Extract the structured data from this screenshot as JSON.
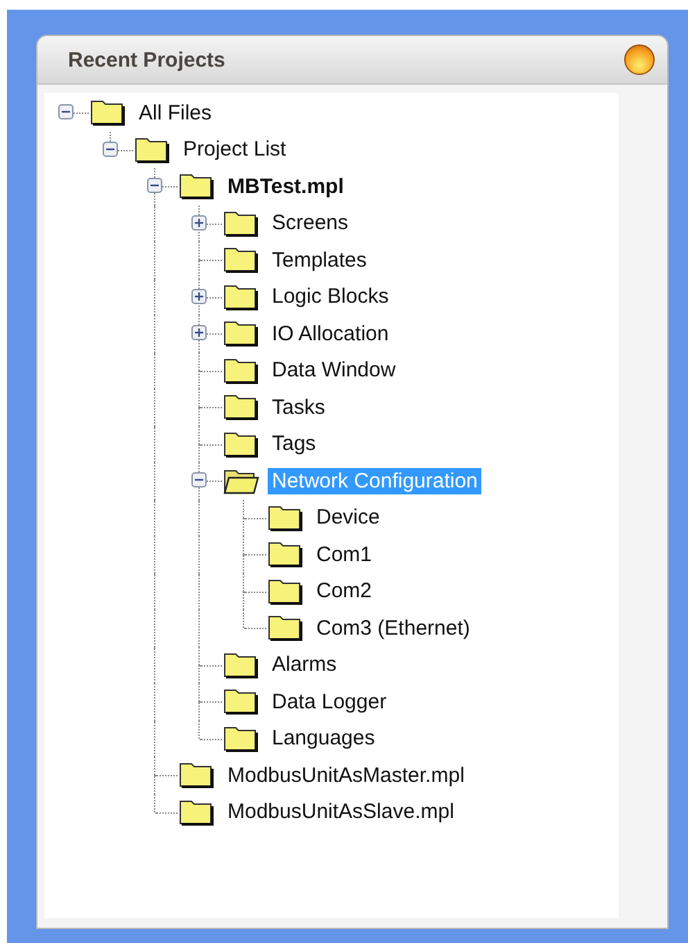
{
  "panel": {
    "title": "Recent Projects"
  },
  "tree": [
    {
      "label": "All Files",
      "expanded": true,
      "selected": false,
      "current": false,
      "children": [
        {
          "label": "Project List",
          "expanded": true,
          "selected": false,
          "current": false,
          "children": [
            {
              "label": "MBTest.mpl",
              "expanded": true,
              "selected": false,
              "current": true,
              "children": [
                {
                  "label": "Screens",
                  "expanded": false,
                  "selected": false,
                  "current": false
                },
                {
                  "label": "Templates",
                  "selected": false,
                  "current": false
                },
                {
                  "label": "Logic Blocks",
                  "expanded": false,
                  "selected": false,
                  "current": false
                },
                {
                  "label": "IO Allocation",
                  "expanded": false,
                  "selected": false,
                  "current": false
                },
                {
                  "label": "Data Window",
                  "selected": false,
                  "current": false
                },
                {
                  "label": "Tasks",
                  "selected": false,
                  "current": false
                },
                {
                  "label": "Tags",
                  "selected": false,
                  "current": false
                },
                {
                  "label": "Network Configuration",
                  "expanded": true,
                  "selected": true,
                  "current": false,
                  "children": [
                    {
                      "label": "Device",
                      "selected": false,
                      "current": false
                    },
                    {
                      "label": "Com1",
                      "selected": false,
                      "current": false
                    },
                    {
                      "label": "Com2",
                      "selected": false,
                      "current": false
                    },
                    {
                      "label": "Com3 (Ethernet)",
                      "selected": false,
                      "current": false
                    }
                  ]
                },
                {
                  "label": "Alarms",
                  "selected": false,
                  "current": false
                },
                {
                  "label": "Data Logger",
                  "selected": false,
                  "current": false
                },
                {
                  "label": "Languages",
                  "selected": false,
                  "current": false
                }
              ]
            },
            {
              "label": "ModbusUnitAsMaster.mpl",
              "selected": false,
              "current": false
            },
            {
              "label": "ModbusUnitAsSlave.mpl",
              "selected": false,
              "current": false
            }
          ]
        }
      ]
    }
  ]
}
